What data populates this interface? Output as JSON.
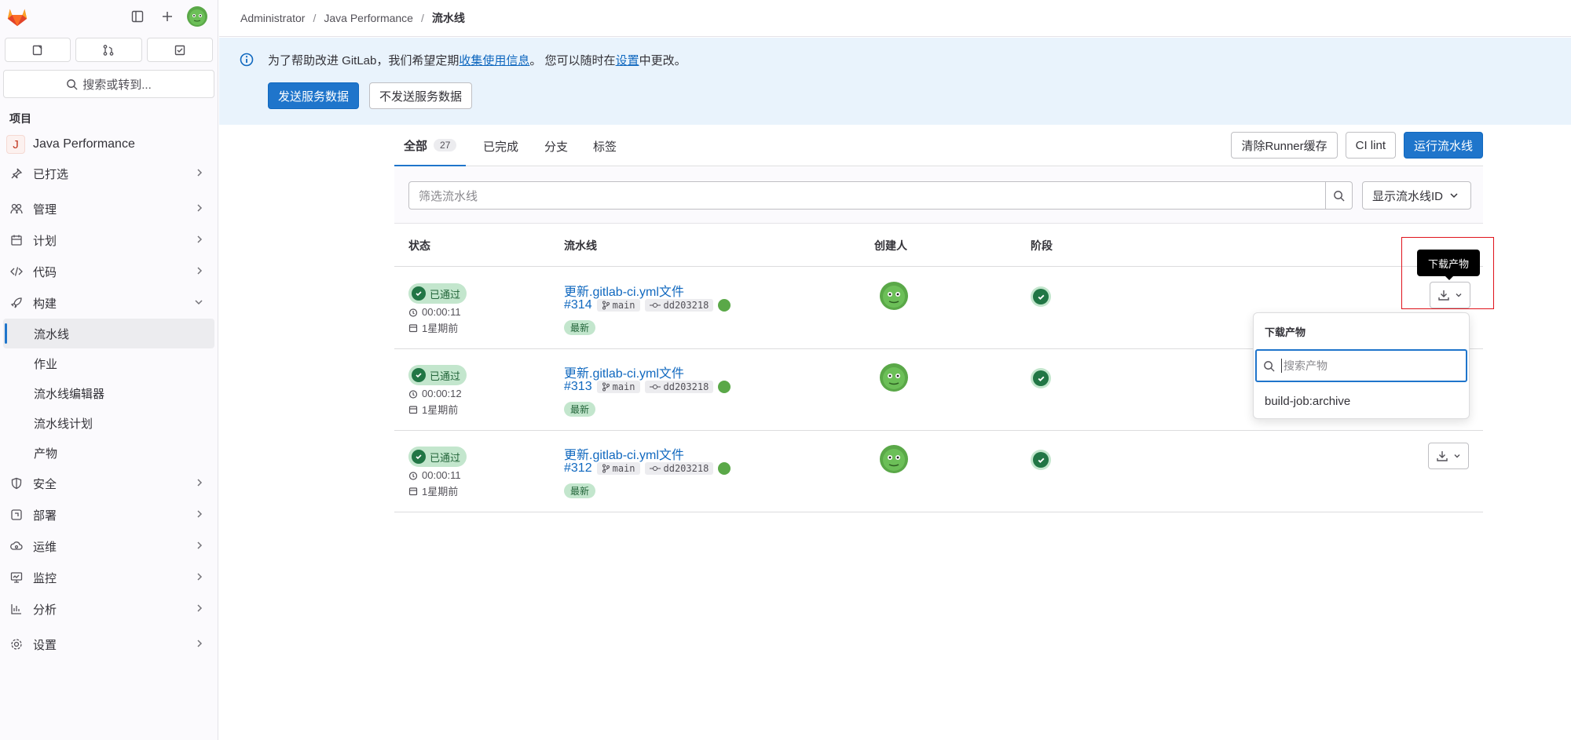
{
  "breadcrumb": [
    "Administrator",
    "Java Performance",
    "流水线"
  ],
  "sidebar": {
    "search": "搜索或转到...",
    "section": "项目",
    "project": {
      "initial": "J",
      "name": "Java Performance"
    },
    "items": [
      {
        "label": "已打选",
        "icon": "pin-icon"
      },
      {
        "label": "管理",
        "icon": "users-icon"
      },
      {
        "label": "计划",
        "icon": "calendar-icon"
      },
      {
        "label": "代码",
        "icon": "code-icon"
      },
      {
        "label": "构建",
        "icon": "rocket-icon"
      }
    ],
    "build_sub": [
      "流水线",
      "作业",
      "流水线编辑器",
      "流水线计划",
      "产物"
    ],
    "items2": [
      {
        "label": "安全",
        "icon": "shield-icon"
      },
      {
        "label": "部署",
        "icon": "deploy-icon"
      },
      {
        "label": "运维",
        "icon": "cloud-icon"
      },
      {
        "label": "监控",
        "icon": "monitor-icon"
      },
      {
        "label": "分析",
        "icon": "chart-icon"
      },
      {
        "label": "设置",
        "icon": "gear-icon"
      }
    ]
  },
  "banner": {
    "msg_pre": "为了帮助改进 GitLab，我们希望定期",
    "link1": "收集使用信息",
    "msg_mid": "。 您可以随时在",
    "link2": "设置",
    "msg_post": "中更改。",
    "send_btn": "发送服务数据",
    "nosend_btn": "不发送服务数据"
  },
  "tabs": {
    "all": "全部",
    "all_count": "27",
    "finished": "已完成",
    "branches": "分支",
    "tags": "标签"
  },
  "actions": {
    "clear_cache": "清除Runner缓存",
    "ci_lint": "CI lint",
    "run": "运行流水线"
  },
  "filter": {
    "placeholder": "筛选流水线",
    "show_id": "显示流水线ID"
  },
  "columns": {
    "status": "状态",
    "pipeline": "流水线",
    "creator": "创建人",
    "stages": "阶段"
  },
  "rows": [
    {
      "status": "已通过",
      "duration": "00:00:11",
      "time": "1星期前",
      "title": "更新.gitlab-ci.yml文件",
      "id": "#314",
      "branch": "main",
      "commit": "dd203218",
      "latest": "最新"
    },
    {
      "status": "已通过",
      "duration": "00:00:12",
      "time": "1星期前",
      "title": "更新.gitlab-ci.yml文件",
      "id": "#313",
      "branch": "main",
      "commit": "dd203218",
      "latest": "最新"
    },
    {
      "status": "已通过",
      "duration": "00:00:11",
      "time": "1星期前",
      "title": "更新.gitlab-ci.yml文件",
      "id": "#312",
      "branch": "main",
      "commit": "dd203218",
      "latest": "最新"
    }
  ],
  "tooltip": "下载产物",
  "dropdown": {
    "title": "下载产物",
    "placeholder": "搜索产物",
    "item": "build-job:archive"
  }
}
